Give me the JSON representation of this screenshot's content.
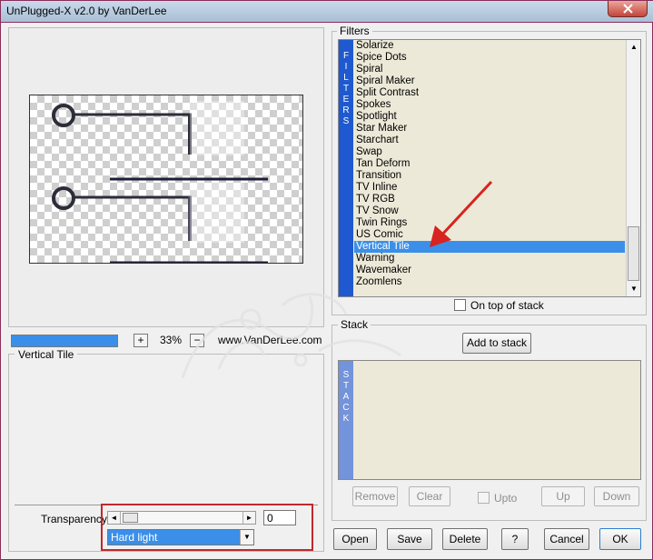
{
  "window": {
    "title": "UnPlugged-X v2.0 by VanDerLee",
    "close_glyph": "✕"
  },
  "preview": {
    "zoom_percent": "33%",
    "zoom_plus": "+",
    "zoom_minus": "−",
    "website": "www.VanDerLee.com",
    "progress": 1.0
  },
  "settings": {
    "title": "Vertical Tile",
    "transparency_label": "Transparency",
    "transparency_value": "0",
    "slider_left": "◄",
    "slider_right": "►",
    "blend_mode": "Hard light",
    "blend_arrow": "▼"
  },
  "filters": {
    "group_label": "Filters",
    "side_letters": [
      "F",
      "I",
      "L",
      "T",
      "E",
      "R",
      "S"
    ],
    "items": [
      "Solarize",
      "Spice Dots",
      "Spiral",
      "Spiral Maker",
      "Split Contrast",
      "Spokes",
      "Spotlight",
      "Star Maker",
      "Starchart",
      "Swap",
      "Tan Deform",
      "Transition",
      "TV Inline",
      "TV RGB",
      "TV Snow",
      "Twin Rings",
      "US Comic",
      "Vertical Tile",
      "Warning",
      "Wavemaker",
      "Zoomlens"
    ],
    "selected": "Vertical Tile",
    "scroll_up": "▲",
    "scroll_down": "▼",
    "on_top_label": "On top of stack"
  },
  "stack": {
    "group_label": "Stack",
    "add_button": "Add to stack",
    "side_letters": [
      "S",
      "T",
      "A",
      "C",
      "K"
    ],
    "remove": "Remove",
    "clear": "Clear",
    "upto": "Upto",
    "up": "Up",
    "down": "Down"
  },
  "buttons": {
    "open": "Open",
    "save": "Save",
    "delete": "Delete",
    "help": "?",
    "cancel": "Cancel",
    "ok": "OK"
  },
  "colors": {
    "selection": "#3b8fe8",
    "filters_bar": "#1f59cf",
    "stack_bar": "#7393da",
    "annotation_red": "#c0282c"
  }
}
